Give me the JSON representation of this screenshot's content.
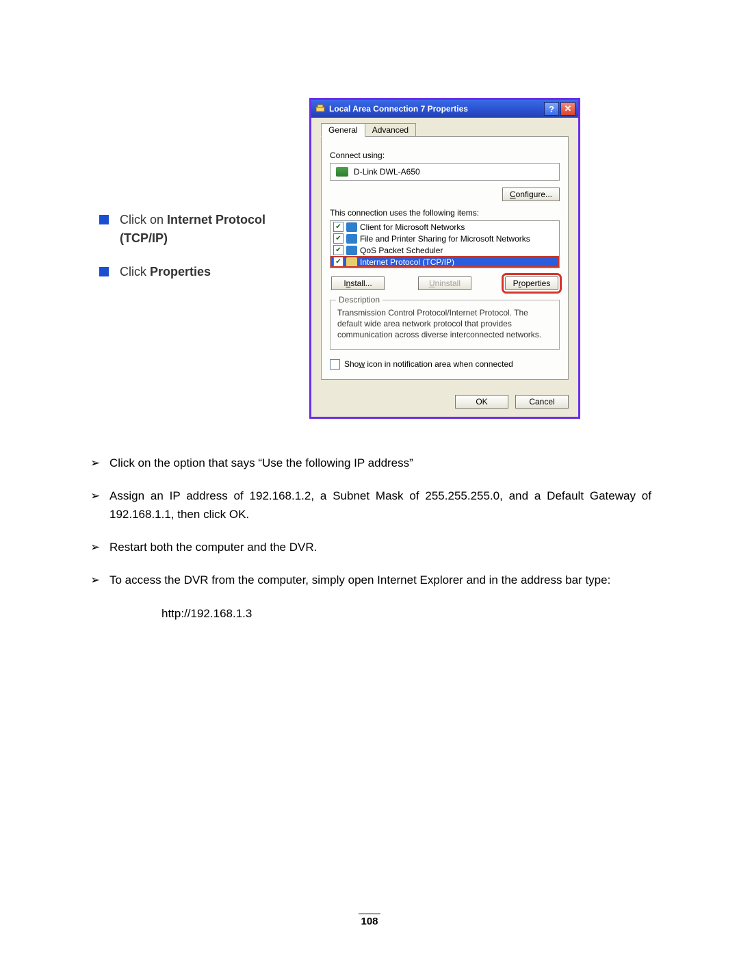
{
  "left": {
    "item1_prefix": "Click on ",
    "item1_bold": "Internet Protocol (TCP/IP)",
    "item2_prefix": "Click ",
    "item2_bold": "Properties"
  },
  "dialog": {
    "title": "Local Area Connection 7 Properties",
    "tabs": {
      "general": "General",
      "advanced": "Advanced"
    },
    "connect_using_label": "Connect using:",
    "adapter": "D-Link DWL-A650",
    "configure": "Configure...",
    "items_label": "This connection uses the following items:",
    "items": {
      "client": "Client for Microsoft Networks",
      "fps": "File and Printer Sharing for Microsoft Networks",
      "qos": "QoS Packet Scheduler",
      "tcpip": "Internet Protocol (TCP/IP)"
    },
    "install": "Install...",
    "uninstall": "Uninstall",
    "properties": "Properties",
    "description_title": "Description",
    "description_text": "Transmission Control Protocol/Internet Protocol. The default wide area network protocol that provides communication across diverse interconnected networks.",
    "show_icon": "Show icon in notification area when connected",
    "ok": "OK",
    "cancel": "Cancel"
  },
  "steps": {
    "s1": "Click on the option that says “Use the following IP address”",
    "s2": "Assign an IP address of 192.168.1.2, a Subnet Mask of 255.255.255.0, and a Default Gateway of 192.168.1.1, then click OK.",
    "s3": "Restart both the computer and the DVR.",
    "s4": "To access the DVR from the computer, simply open Internet Explorer and in the address bar type:",
    "url": "http://192.168.1.3"
  },
  "page_number": "108",
  "glyphs": {
    "arrow": "➢",
    "help": "?",
    "close": "✕"
  }
}
